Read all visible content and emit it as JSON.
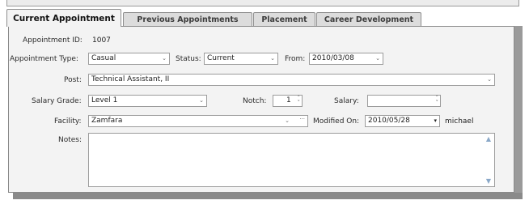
{
  "tabs": [
    {
      "label": "Current Appointment",
      "active": true
    },
    {
      "label": "Previous Appointments",
      "active": false
    },
    {
      "label": "Placement",
      "active": false
    },
    {
      "label": "Career Development",
      "active": false
    }
  ],
  "form": {
    "appointment_id_label": "Appointment ID:",
    "appointment_id_value": "1007",
    "appointment_type_label": "Appointment Type:",
    "appointment_type_value": "Casual",
    "status_label": "Status:",
    "status_value": "Current",
    "from_label": "From:",
    "from_value": "2010/03/08",
    "post_label": "Post:",
    "post_value": "Technical Assistant, II",
    "salary_grade_label": "Salary Grade:",
    "salary_grade_value": "Level 1",
    "notch_label": "Notch:",
    "notch_value": "1",
    "salary_label": "Salary:",
    "salary_value": "",
    "facility_label": "Facility:",
    "facility_value": "Zamfara",
    "facility_more": "···",
    "modified_on_label": "Modified On:",
    "modified_on_value": "2010/05/28",
    "modified_by": "michael",
    "notes_label": "Notes:",
    "notes_value": ""
  },
  "icons": {
    "dropdown": "chevron-down-icon",
    "spinner": "spinner-icon",
    "scroll_up": "scroll-up-icon",
    "scroll_down": "scroll-down-icon"
  }
}
